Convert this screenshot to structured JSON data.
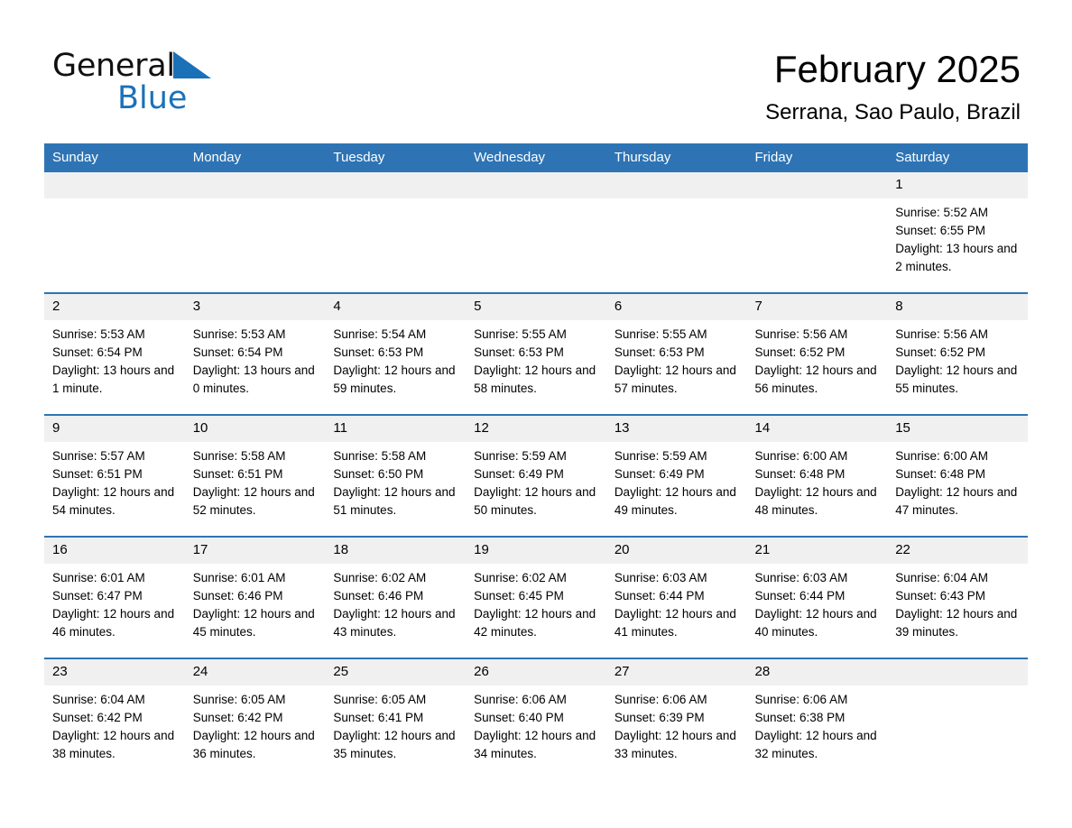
{
  "brand": {
    "name_part1": "General",
    "name_part2": "Blue",
    "accent_color": "#1b71b8"
  },
  "header": {
    "title": "February 2025",
    "subtitle": "Serrana, Sao Paulo, Brazil"
  },
  "calendar": {
    "header_bg": "#2e74b5",
    "daynum_bg": "#f0f0f0",
    "weekday_headers": [
      "Sunday",
      "Monday",
      "Tuesday",
      "Wednesday",
      "Thursday",
      "Friday",
      "Saturday"
    ],
    "weeks": [
      [
        {
          "day": "",
          "empty": true
        },
        {
          "day": "",
          "empty": true
        },
        {
          "day": "",
          "empty": true
        },
        {
          "day": "",
          "empty": true
        },
        {
          "day": "",
          "empty": true
        },
        {
          "day": "",
          "empty": true
        },
        {
          "day": "1",
          "sunrise": "Sunrise: 5:52 AM",
          "sunset": "Sunset: 6:55 PM",
          "daylight": "Daylight: 13 hours and 2 minutes."
        }
      ],
      [
        {
          "day": "2",
          "sunrise": "Sunrise: 5:53 AM",
          "sunset": "Sunset: 6:54 PM",
          "daylight": "Daylight: 13 hours and 1 minute."
        },
        {
          "day": "3",
          "sunrise": "Sunrise: 5:53 AM",
          "sunset": "Sunset: 6:54 PM",
          "daylight": "Daylight: 13 hours and 0 minutes."
        },
        {
          "day": "4",
          "sunrise": "Sunrise: 5:54 AM",
          "sunset": "Sunset: 6:53 PM",
          "daylight": "Daylight: 12 hours and 59 minutes."
        },
        {
          "day": "5",
          "sunrise": "Sunrise: 5:55 AM",
          "sunset": "Sunset: 6:53 PM",
          "daylight": "Daylight: 12 hours and 58 minutes."
        },
        {
          "day": "6",
          "sunrise": "Sunrise: 5:55 AM",
          "sunset": "Sunset: 6:53 PM",
          "daylight": "Daylight: 12 hours and 57 minutes."
        },
        {
          "day": "7",
          "sunrise": "Sunrise: 5:56 AM",
          "sunset": "Sunset: 6:52 PM",
          "daylight": "Daylight: 12 hours and 56 minutes."
        },
        {
          "day": "8",
          "sunrise": "Sunrise: 5:56 AM",
          "sunset": "Sunset: 6:52 PM",
          "daylight": "Daylight: 12 hours and 55 minutes."
        }
      ],
      [
        {
          "day": "9",
          "sunrise": "Sunrise: 5:57 AM",
          "sunset": "Sunset: 6:51 PM",
          "daylight": "Daylight: 12 hours and 54 minutes."
        },
        {
          "day": "10",
          "sunrise": "Sunrise: 5:58 AM",
          "sunset": "Sunset: 6:51 PM",
          "daylight": "Daylight: 12 hours and 52 minutes."
        },
        {
          "day": "11",
          "sunrise": "Sunrise: 5:58 AM",
          "sunset": "Sunset: 6:50 PM",
          "daylight": "Daylight: 12 hours and 51 minutes."
        },
        {
          "day": "12",
          "sunrise": "Sunrise: 5:59 AM",
          "sunset": "Sunset: 6:49 PM",
          "daylight": "Daylight: 12 hours and 50 minutes."
        },
        {
          "day": "13",
          "sunrise": "Sunrise: 5:59 AM",
          "sunset": "Sunset: 6:49 PM",
          "daylight": "Daylight: 12 hours and 49 minutes."
        },
        {
          "day": "14",
          "sunrise": "Sunrise: 6:00 AM",
          "sunset": "Sunset: 6:48 PM",
          "daylight": "Daylight: 12 hours and 48 minutes."
        },
        {
          "day": "15",
          "sunrise": "Sunrise: 6:00 AM",
          "sunset": "Sunset: 6:48 PM",
          "daylight": "Daylight: 12 hours and 47 minutes."
        }
      ],
      [
        {
          "day": "16",
          "sunrise": "Sunrise: 6:01 AM",
          "sunset": "Sunset: 6:47 PM",
          "daylight": "Daylight: 12 hours and 46 minutes."
        },
        {
          "day": "17",
          "sunrise": "Sunrise: 6:01 AM",
          "sunset": "Sunset: 6:46 PM",
          "daylight": "Daylight: 12 hours and 45 minutes."
        },
        {
          "day": "18",
          "sunrise": "Sunrise: 6:02 AM",
          "sunset": "Sunset: 6:46 PM",
          "daylight": "Daylight: 12 hours and 43 minutes."
        },
        {
          "day": "19",
          "sunrise": "Sunrise: 6:02 AM",
          "sunset": "Sunset: 6:45 PM",
          "daylight": "Daylight: 12 hours and 42 minutes."
        },
        {
          "day": "20",
          "sunrise": "Sunrise: 6:03 AM",
          "sunset": "Sunset: 6:44 PM",
          "daylight": "Daylight: 12 hours and 41 minutes."
        },
        {
          "day": "21",
          "sunrise": "Sunrise: 6:03 AM",
          "sunset": "Sunset: 6:44 PM",
          "daylight": "Daylight: 12 hours and 40 minutes."
        },
        {
          "day": "22",
          "sunrise": "Sunrise: 6:04 AM",
          "sunset": "Sunset: 6:43 PM",
          "daylight": "Daylight: 12 hours and 39 minutes."
        }
      ],
      [
        {
          "day": "23",
          "sunrise": "Sunrise: 6:04 AM",
          "sunset": "Sunset: 6:42 PM",
          "daylight": "Daylight: 12 hours and 38 minutes."
        },
        {
          "day": "24",
          "sunrise": "Sunrise: 6:05 AM",
          "sunset": "Sunset: 6:42 PM",
          "daylight": "Daylight: 12 hours and 36 minutes."
        },
        {
          "day": "25",
          "sunrise": "Sunrise: 6:05 AM",
          "sunset": "Sunset: 6:41 PM",
          "daylight": "Daylight: 12 hours and 35 minutes."
        },
        {
          "day": "26",
          "sunrise": "Sunrise: 6:06 AM",
          "sunset": "Sunset: 6:40 PM",
          "daylight": "Daylight: 12 hours and 34 minutes."
        },
        {
          "day": "27",
          "sunrise": "Sunrise: 6:06 AM",
          "sunset": "Sunset: 6:39 PM",
          "daylight": "Daylight: 12 hours and 33 minutes."
        },
        {
          "day": "28",
          "sunrise": "Sunrise: 6:06 AM",
          "sunset": "Sunset: 6:38 PM",
          "daylight": "Daylight: 12 hours and 32 minutes."
        },
        {
          "day": "",
          "empty": true
        }
      ]
    ]
  }
}
